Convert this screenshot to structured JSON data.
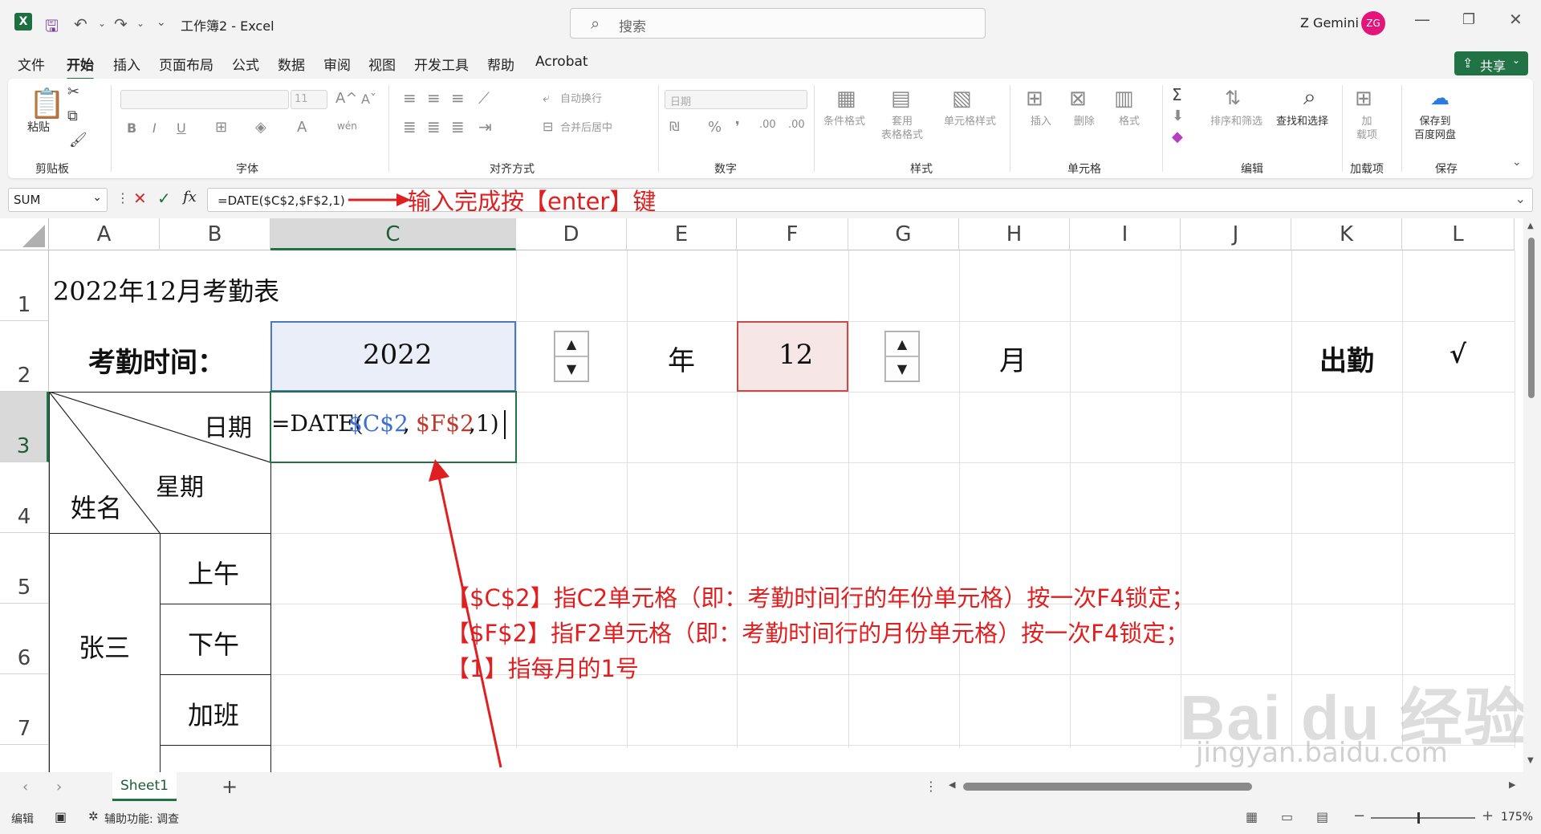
{
  "titlebar": {
    "doc_title": "工作簿2 - Excel",
    "search_placeholder": "搜索",
    "user_name": "Z Gemini",
    "avatar_initials": "ZG",
    "avatar_color": "#e3147a"
  },
  "menu": [
    "文件",
    "开始",
    "插入",
    "页面布局",
    "公式",
    "数据",
    "审阅",
    "视图",
    "开发工具",
    "帮助",
    "Acrobat"
  ],
  "share_label": "共享",
  "ribbon": {
    "clipboard": {
      "paste": "粘贴",
      "group": "剪贴板"
    },
    "font": {
      "size": "11",
      "group": "字体",
      "bold": "B",
      "italic": "I",
      "underline": "U"
    },
    "alignment": {
      "wrap": "自动换行",
      "merge": "合并后居中",
      "group": "对齐方式"
    },
    "number": {
      "format": "日期",
      "group": "数字"
    },
    "styles": {
      "conditional": "条件格式",
      "table": "套用\n表格格式",
      "cell": "单元格样式",
      "group": "样式"
    },
    "cells": {
      "insert": "插入",
      "delete": "删除",
      "format": "格式",
      "group": "单元格"
    },
    "editing": {
      "sort": "排序和筛选",
      "find": "查找和选择",
      "group": "编辑"
    },
    "addins": {
      "addin": "加\n载项",
      "group": "加载项"
    },
    "save": {
      "baidu": "保存到\n百度网盘",
      "group": "保存"
    }
  },
  "formula_bar": {
    "name_box": "SUM",
    "formula": "=DATE($C$2,$F$2,1)",
    "annotation": "输入完成按【enter】键"
  },
  "columns": [
    "A",
    "B",
    "C",
    "D",
    "E",
    "F",
    "G",
    "H",
    "I",
    "J",
    "K",
    "L"
  ],
  "rows": [
    "1",
    "2",
    "3",
    "4",
    "5",
    "6",
    "7"
  ],
  "cells": {
    "a1": "2022年12月考勤表",
    "a2": "考勤时间：",
    "c2": "2022",
    "e2": "年",
    "f2": "12",
    "h2": "月",
    "k2": "出勤",
    "l2": "√",
    "b3": "日期",
    "b4": "星期",
    "a4": "姓名",
    "a6": "张三",
    "b5": "上午",
    "b6": "下午",
    "b7": "加班",
    "c3_formula_prefix": "=DATE(",
    "c3_ref1": "$C$2",
    "c3_comma": ",",
    "c3_ref2": "$F$2",
    "c3_tail": ",1)"
  },
  "colors": {
    "ref1": "#3c6fd8",
    "ref2": "#c0392b",
    "selection": "#217346",
    "annotation": "#e02020"
  },
  "notes": [
    "【$C$2】指C2单元格（即：考勤时间行的年份单元格）按一次F4锁定；",
    "【$F$2】指F2单元格（即：考勤时间行的月份单元格）按一次F4锁定；",
    "【1】指每月的1号"
  ],
  "sheet_tab": "Sheet1",
  "status": {
    "mode": "编辑",
    "accessibility": "辅助功能: 调查",
    "zoom": "175%"
  },
  "watermark": {
    "brand": "Bai du 经验",
    "url": "jingyan.baidu.com"
  }
}
